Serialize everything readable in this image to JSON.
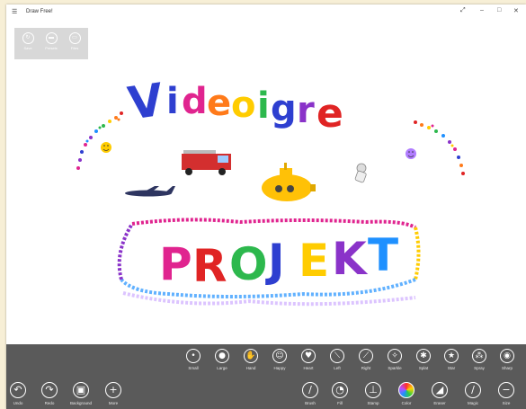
{
  "window": {
    "title": "Draw Free!",
    "menu_icon": "hamburger-icon",
    "controls": [
      "fullscreen-icon",
      "minimize-icon",
      "maximize-icon",
      "close-icon"
    ]
  },
  "mini_toolbar": [
    {
      "label": "Save",
      "icon": "save-icon"
    },
    {
      "label": "Presets",
      "icon": "presets-icon"
    },
    {
      "label": "Files",
      "icon": "files-icon"
    }
  ],
  "canvas": {
    "heading": "Videoigre",
    "heading_letters": [
      "V",
      "i",
      "d",
      "e",
      "o",
      "i",
      "g",
      "r",
      "e"
    ],
    "heading_colors": [
      "#2e3fd0",
      "#2e3fd0",
      "#e0248f",
      "#ff7a1a",
      "#ffcc00",
      "#2db84d",
      "#2e3fd0",
      "#8a33c9",
      "#e02424"
    ],
    "subheading": "PROJEKT",
    "subheading_letters": [
      "P",
      "R",
      "O",
      "J",
      "E",
      "K",
      "T"
    ],
    "subheading_colors": [
      "#e0248f",
      "#e02424",
      "#2db84d",
      "#2e3fd0",
      "#ffcc00",
      "#8a33c9",
      "#1e90ff"
    ],
    "stamps": [
      "airplane-stamp",
      "fire-truck-stamp",
      "submarine-stamp",
      "astronaut-stamp",
      "smiley-stamp"
    ]
  },
  "brushes": [
    {
      "label": "Small",
      "icon": "small-brush-icon",
      "glyph": "•"
    },
    {
      "label": "Large",
      "icon": "large-brush-icon",
      "glyph": "●"
    },
    {
      "label": "Hand",
      "icon": "hand-icon",
      "glyph": "✋"
    },
    {
      "label": "Happy",
      "icon": "happy-icon",
      "glyph": "☺"
    },
    {
      "label": "Heart",
      "icon": "heart-icon",
      "glyph": "♥"
    },
    {
      "label": "Left",
      "icon": "left-slash-icon",
      "glyph": "⟍"
    },
    {
      "label": "Right",
      "icon": "right-slash-icon",
      "glyph": "⟋"
    },
    {
      "label": "Sparkle",
      "icon": "sparkle-icon",
      "glyph": "✧"
    },
    {
      "label": "Splat",
      "icon": "splat-icon",
      "glyph": "✱"
    },
    {
      "label": "Star",
      "icon": "star-icon",
      "glyph": "★"
    },
    {
      "label": "Spray",
      "icon": "spray-icon",
      "glyph": "⁂"
    },
    {
      "label": "Sharp",
      "icon": "sharp-icon",
      "glyph": "◉"
    }
  ],
  "actions_left": [
    {
      "label": "Undo",
      "icon": "undo-icon",
      "glyph": "↶"
    },
    {
      "label": "Redo",
      "icon": "redo-icon",
      "glyph": "↷"
    },
    {
      "label": "Background",
      "icon": "background-icon",
      "glyph": "▣"
    },
    {
      "label": "More",
      "icon": "plus-icon",
      "glyph": "+"
    }
  ],
  "actions_right": [
    {
      "label": "Brush",
      "icon": "brush-icon",
      "glyph": "∕"
    },
    {
      "label": "Fill",
      "icon": "fill-icon",
      "glyph": "◔"
    },
    {
      "label": "Stamp",
      "icon": "stamp-icon",
      "glyph": "⊥"
    },
    {
      "label": "Color",
      "icon": "color-icon",
      "glyph": ""
    },
    {
      "label": "Eraser",
      "icon": "eraser-icon",
      "glyph": "◢"
    },
    {
      "label": "Magic",
      "icon": "magic-icon",
      "glyph": "∕"
    },
    {
      "label": "Size",
      "icon": "size-icon",
      "glyph": "−"
    }
  ]
}
